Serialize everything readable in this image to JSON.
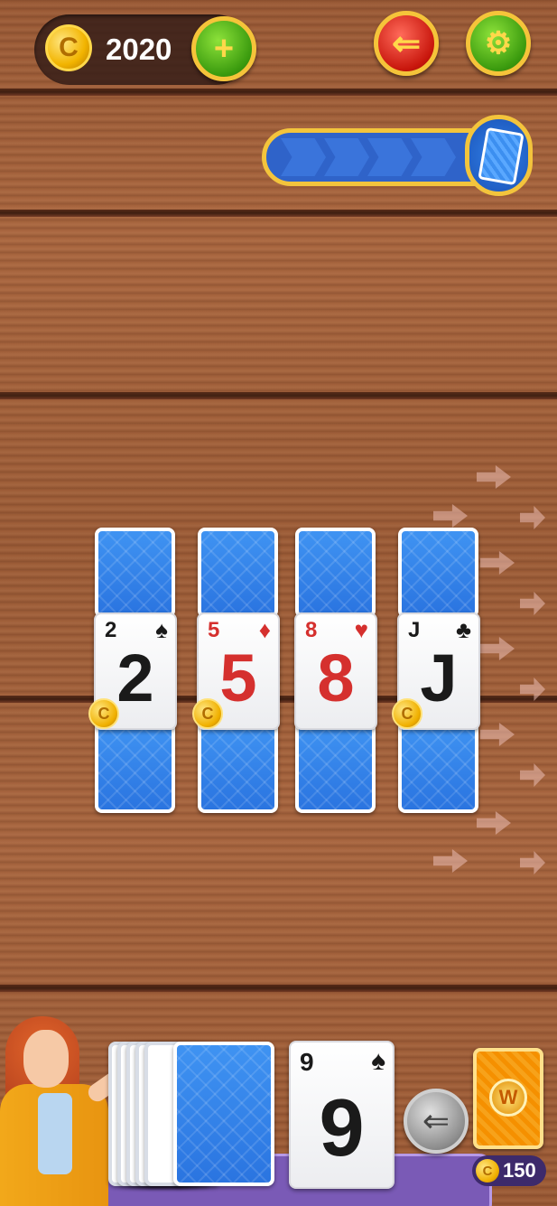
{
  "header": {
    "coin_symbol": "C",
    "coin_count": "2020",
    "add_coins_symbol": "+",
    "back_symbol": "⇐",
    "settings_symbol": "⚙"
  },
  "progress": {
    "filled_chevrons": 4,
    "total_chevrons": 4
  },
  "columns": [
    {
      "rank": "2",
      "suit": "♠",
      "color": "black",
      "has_coin": true
    },
    {
      "rank": "5",
      "suit": "♦",
      "color": "red",
      "has_coin": true
    },
    {
      "rank": "8",
      "suit": "♥",
      "color": "red",
      "has_coin": false
    },
    {
      "rank": "J",
      "suit": "♣",
      "color": "black",
      "has_coin": true
    }
  ],
  "waste_card": {
    "rank": "9",
    "suit": "♠",
    "color": "black"
  },
  "undo_symbol": "⇐",
  "wild": {
    "label": "W",
    "price": "150",
    "coin_symbol": "C"
  },
  "colors": {
    "accent_gold": "#f5c43a",
    "card_blue": "#2a74e0",
    "tray_purple": "#7a5ab6"
  }
}
